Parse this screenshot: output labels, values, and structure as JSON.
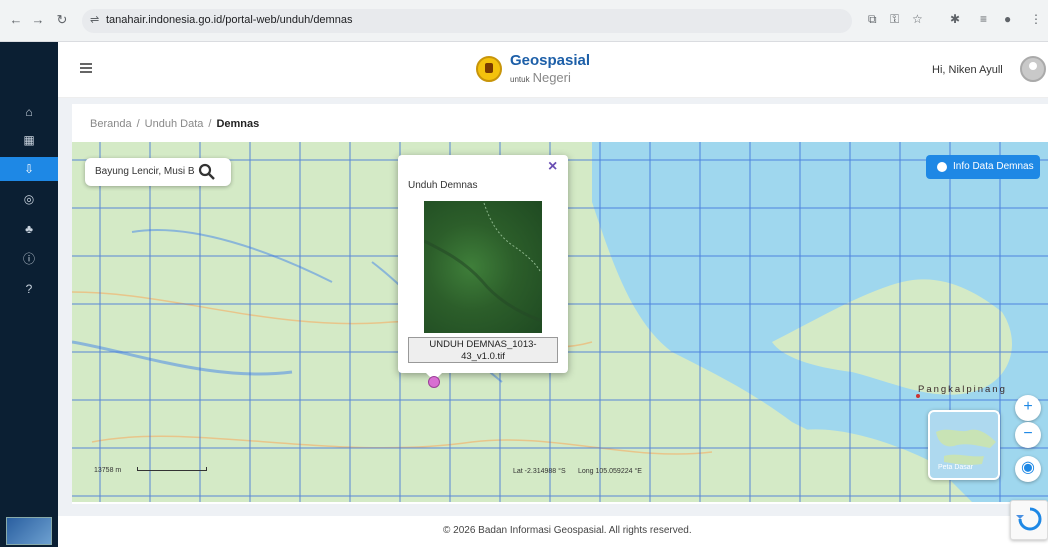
{
  "browser": {
    "back_icon": "arrow-left-icon",
    "forward_icon": "arrow-right-icon",
    "reload_icon": "reload-icon",
    "url": "tanahair.indonesia.go.id/portal-web/unduh/demnas"
  },
  "sidebar": {
    "items": [
      {
        "icon": "home-icon",
        "glyph": "⌂"
      },
      {
        "icon": "grid-icon",
        "glyph": "▦"
      },
      {
        "icon": "download-icon",
        "glyph": "⇩",
        "active": true
      },
      {
        "icon": "location-icon",
        "glyph": "◎"
      },
      {
        "icon": "network-icon",
        "glyph": "♣"
      },
      {
        "icon": "info-icon",
        "glyph": "ⓘ"
      },
      {
        "icon": "help-icon",
        "glyph": "?"
      }
    ]
  },
  "header": {
    "brand_title": "Geospasial",
    "brand_sub_small": "untuk",
    "brand_sub": "Negeri",
    "greeting": "Hi, Niken Ayull"
  },
  "breadcrumb": {
    "home": "Beranda",
    "section": "Unduh Data",
    "current": "Demnas",
    "separator": "/"
  },
  "map": {
    "search_value": "Bayung Lencir, Musi Ba",
    "info_button": "Info Data Demnas",
    "city_label": "Pangkalpinang",
    "minimap_label": "Peta Dasar",
    "scale": "13758 m",
    "latitude": "Lat -2.314988 °S",
    "longitude": "Long 105.059224 °E",
    "zoom_in": "+",
    "zoom_out": "−"
  },
  "popup": {
    "title": "Unduh Demnas",
    "close": "×",
    "download_line1": "UNDUH DEMNAS_1013-",
    "download_line2": "43_v1.0.tif"
  },
  "footer": {
    "text": "© 2026 Badan Informasi Geospasial. All rights reserved."
  },
  "colors": {
    "sidebar_bg": "#0b1f33",
    "accent": "#1e88e5",
    "land": "#cfe8c2",
    "sea": "#9fd7ee",
    "grid": "#3a6fd9",
    "marker": "#d86fd2"
  }
}
